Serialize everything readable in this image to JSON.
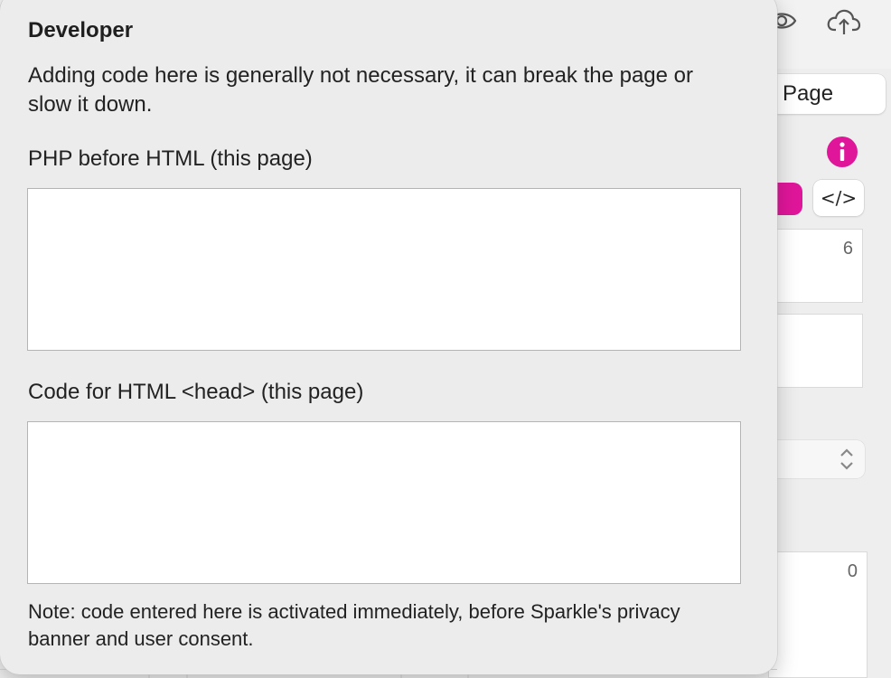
{
  "background": {
    "page_tab_label": "Page",
    "code_button_label": "</>",
    "field_top_value": "6",
    "field_bottom_value": "0",
    "accent_color": "#e0169a",
    "icons": [
      "eye-icon",
      "cloud-upload-icon",
      "info-icon",
      "chevron-updown-icon"
    ]
  },
  "popover": {
    "title": "Developer",
    "description": "Adding code here is generally not necessary, it can break the page or slow it down.",
    "php_label": "PHP before HTML (this page)",
    "php_value": "",
    "head_label": "Code for HTML <head> (this page)",
    "head_value": "",
    "note": "Note: code entered here is activated immediately, before Sparkle's privacy banner and user consent."
  }
}
